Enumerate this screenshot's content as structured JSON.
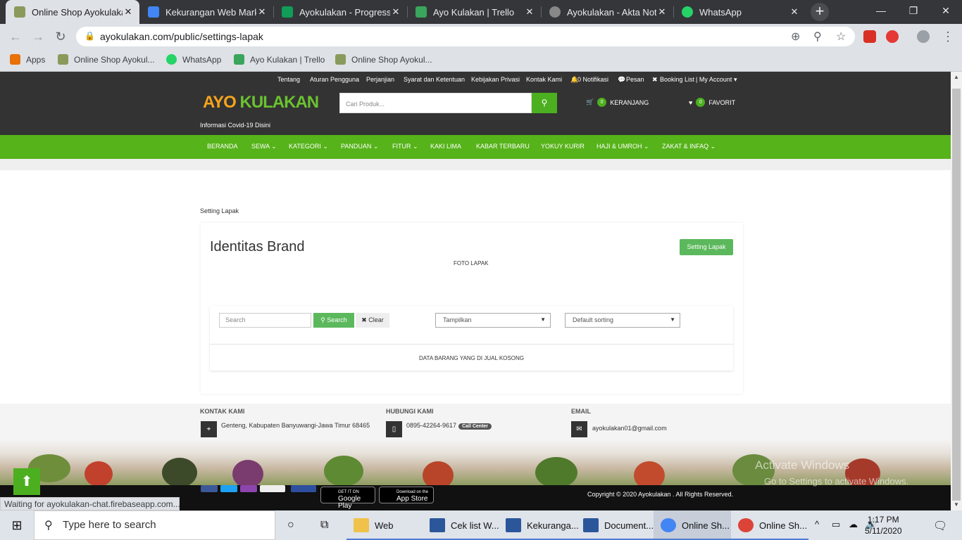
{
  "browser": {
    "tabs": [
      {
        "title": "Online Shop Ayokulakan",
        "color": "#8a9a5b",
        "active": true
      },
      {
        "title": "Kekurangan Web Market",
        "color": "#4285f4",
        "active": false
      },
      {
        "title": "Ayokulakan - Progress",
        "color": "#0f9d58",
        "active": false
      },
      {
        "title": "Ayo Kulakan | Trello",
        "color": "#3aa55c",
        "active": false
      },
      {
        "title": "Ayokulakan - Akta Nota",
        "color": "#888888",
        "active": false
      },
      {
        "title": "WhatsApp",
        "color": "#25d366",
        "active": false
      }
    ],
    "url": "ayokulakan.com/public/settings-lapak",
    "bookmarks": [
      {
        "label": "Apps",
        "color": "#e8710a"
      },
      {
        "label": "Online Shop Ayokul...",
        "color": "#8a9a5b"
      },
      {
        "label": "WhatsApp",
        "color": "#25d366"
      },
      {
        "label": "Ayo Kulakan | Trello",
        "color": "#3aa55c"
      },
      {
        "label": "Online Shop Ayokul...",
        "color": "#8a9a5b"
      }
    ]
  },
  "header": {
    "top_links": [
      "Tentang",
      "Aturan Pengguna",
      "Perjanjian",
      "Syarat dan Ketentuan",
      "Kebijakan Privasi",
      "Kontak Kami",
      "0 Notifikasi",
      "Pesan",
      "Booking List",
      "| My Account"
    ],
    "logo_part1": "AYO ",
    "logo_part2": "KULAKAN",
    "covid_link": "Informasi Covid-19 Disini",
    "search_placeholder": "Cari Produk...",
    "cart_count": "0",
    "cart_label": "KERANJANG",
    "fav_count": "0",
    "fav_label": "FAVORIT",
    "menu": [
      "BERANDA",
      "SEWA ⌄",
      "KATEGORI ⌄",
      "PANDUAN ⌄",
      "FITUR ⌄",
      "KAKI LIMA",
      "KABAR TERBARU",
      "YOKUY KURIR",
      "HAJI & UMROH ⌄",
      "ZAKAT & INFAQ ⌄"
    ]
  },
  "content": {
    "breadcrumb": "Setting Lapak",
    "title": "Identitas Brand",
    "setting_button": "Setting Lapak",
    "foto_label": "FOTO LAPAK",
    "filter": {
      "search_placeholder": "Search",
      "search_button": "Search",
      "clear_button": "Clear",
      "display_select": "Tampilkan",
      "sort_select": "Default sorting"
    },
    "empty_message": "DATA BARANG YANG DI JUAL KOSONG"
  },
  "footer": {
    "contact_heading": "KONTAK KAMI",
    "contact_address": "Genteng, Kabupaten Banyuwangi-Jawa Timur 68465",
    "phone_heading": "HUBUNGI KAMI",
    "phone": "0895-42264-9617",
    "call_center": "Call Center",
    "email_heading": "EMAIL",
    "email": "ayokulakan01@gmail.com",
    "copyright": "Copyright © 2020 Ayokulakan . All Rights Reserved.",
    "google_play_small": "GET IT ON",
    "google_play": "Google Play",
    "app_store_small": "Download on the",
    "app_store": "App Store",
    "watermark_line1": "Activate Windows",
    "watermark_line2": "Go to Settings to activate Windows."
  },
  "status_text": "Waiting for ayokulakan-chat.firebaseapp.com...",
  "taskbar": {
    "search_placeholder": "Type here to search",
    "items": [
      {
        "label": "Web",
        "color": "#f0c24a"
      },
      {
        "label": "Cek list W...",
        "color": "#2b579a"
      },
      {
        "label": "Kekuranga...",
        "color": "#2b579a"
      },
      {
        "label": "Document...",
        "color": "#2b579a"
      },
      {
        "label": "Online Sh...",
        "color": "#4285f4"
      },
      {
        "label": "Online Sh...",
        "color": "#db4437"
      }
    ],
    "time": "1:17 PM",
    "date": "5/11/2020"
  }
}
